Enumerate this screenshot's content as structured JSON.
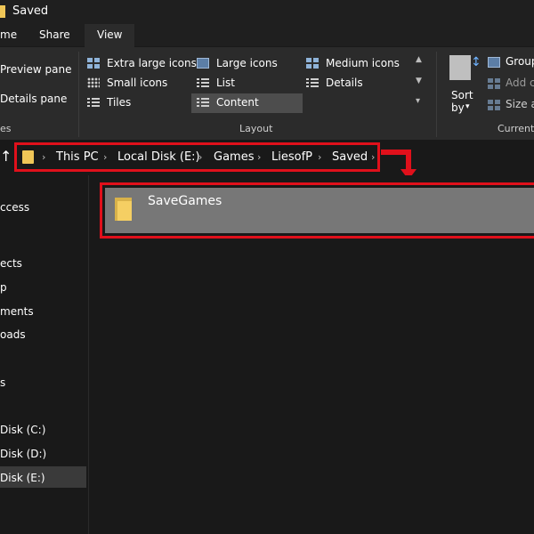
{
  "window": {
    "title": "Saved"
  },
  "tabs": [
    {
      "label": "me",
      "selected": false
    },
    {
      "label": "Share",
      "selected": false
    },
    {
      "label": "View",
      "selected": true
    }
  ],
  "ribbon": {
    "panes": {
      "preview": "Preview pane",
      "details": "Details pane",
      "section_label_partial": "es"
    },
    "layout": {
      "items": [
        "Extra large icons",
        "Large icons",
        "Medium icons",
        "Small icons",
        "List",
        "Details",
        "Tiles",
        "Content"
      ],
      "selected": "Content",
      "section_label": "Layout"
    },
    "current_view": {
      "sort_label_1": "Sort",
      "sort_label_2": "by",
      "group": "Group",
      "add": "Add c",
      "size": "Size a",
      "section_label_partial": "Current"
    }
  },
  "address": {
    "up_icon": "↑",
    "crumbs": [
      "This PC",
      "Local Disk (E:)",
      "Games",
      "LiesofP",
      "Saved"
    ],
    "separator": "›",
    "highlight_color": "#e0101b"
  },
  "nav": {
    "items": [
      "ccess",
      "ects",
      "p",
      "ments",
      "oads",
      "s",
      "Disk (C:)",
      "Disk (D:)",
      "Disk (E:)"
    ],
    "selected": "Disk (E:)"
  },
  "content": {
    "items": [
      {
        "name": "SaveGames",
        "type": "folder",
        "selected": true
      }
    ]
  },
  "colors": {
    "folder": "#f0c657",
    "ribbon_bg": "#2b2b2b",
    "window_bg": "#191919",
    "selection": "#777777",
    "annotation": "#e0101b"
  }
}
